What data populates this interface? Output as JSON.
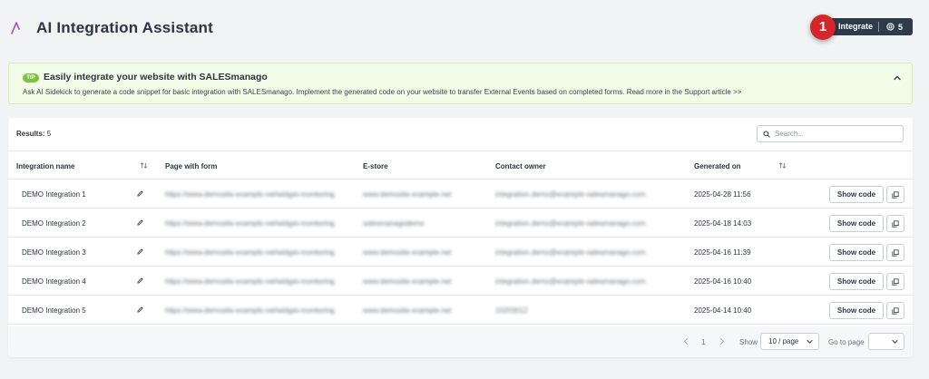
{
  "header": {
    "title": "AI Integration Assistant",
    "logo_icon": "ai-logo-icon",
    "badge": "1",
    "integrate_label": "Integrate",
    "credits": "5",
    "credits_icon": "credits-icon"
  },
  "tip": {
    "badge": "TIP",
    "title": "Easily integrate your website with SALESmanago",
    "text": "Ask AI Sidekick to generate a code snippet for basic integration with SALESmanago. Implement the generated code on your website to transfer External Events based on completed forms. Read more in the Support article >>",
    "toggle_icon": "chevron-up-icon"
  },
  "table": {
    "results_label": "Results:",
    "results_count": "5",
    "search_placeholder": "Search...",
    "columns": {
      "name": "Integration name",
      "page": "Page with form",
      "estore": "E-store",
      "owner": "Contact owner",
      "generated": "Generated on"
    },
    "show_code_label": "Show code",
    "rows": [
      {
        "name": "DEMO Integration 1",
        "page": "https://www.demosite.example.net/widget-monitoring",
        "estore": "www.demosite.example.net",
        "owner": "integration.demo@example-salesmanago.com",
        "generated": "2025-04-28 11:56"
      },
      {
        "name": "DEMO Integration 2",
        "page": "https://www.demosite.example.net/widget-monitoring",
        "estore": "salesmanagodemo",
        "owner": "integration.demo@example-salesmanago.com",
        "generated": "2025-04-18 14:03"
      },
      {
        "name": "DEMO Integration 3",
        "page": "https://www.demosite.example.net/widget-monitoring",
        "estore": "www.demosite.example.net",
        "owner": "integration.demo@example-salesmanago.com",
        "generated": "2025-04-16 11:39"
      },
      {
        "name": "DEMO Integration 4",
        "page": "https://www.demosite.example.net/widget-monitoring",
        "estore": "www.demosite.example.net",
        "owner": "integration.demo@example-salesmanago.com",
        "generated": "2025-04-16 10:40"
      },
      {
        "name": "DEMO Integration 5",
        "page": "https://www.demosite.example.net/widget-monitoring",
        "estore": "www.demosite.example.net",
        "owner": "10203012",
        "generated": "2025-04-14 10:40"
      }
    ]
  },
  "pagination": {
    "current_page": "1",
    "show_label": "Show",
    "per_page": "10 / page",
    "goto_label": "Go to page"
  }
}
